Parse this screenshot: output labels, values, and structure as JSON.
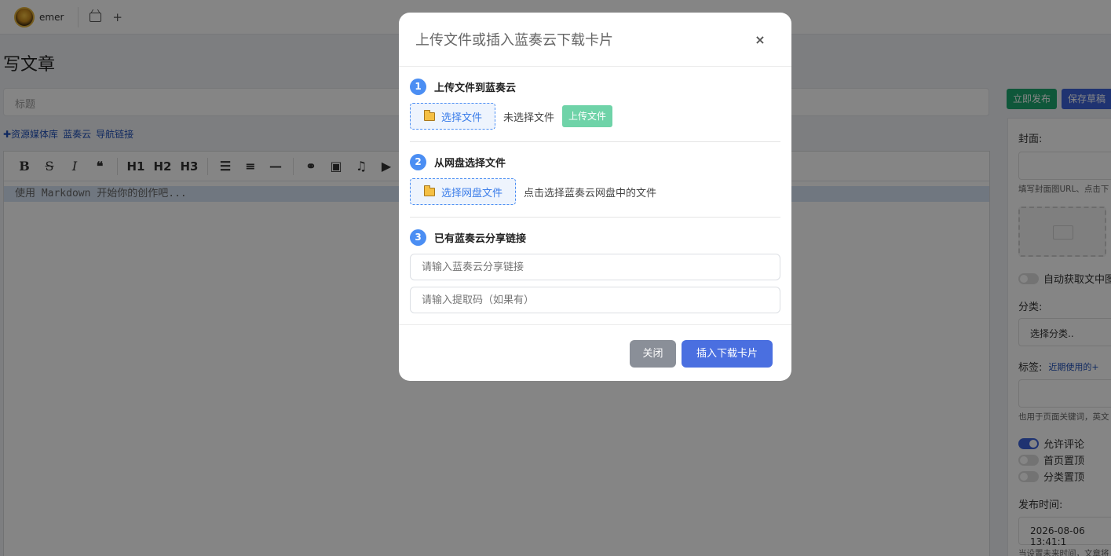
{
  "topbar": {
    "username": "emer",
    "add_symbol": "+"
  },
  "page": {
    "title": "写文章",
    "title_placeholder": "标题",
    "quick_links": [
      "✚资源媒体库",
      "蓝奏云",
      "导航链接"
    ],
    "toolbar": [
      "B",
      "S",
      "I",
      "❝",
      "H1",
      "H2",
      "H3",
      "☰",
      "≡",
      "—",
      "⚭",
      "▣",
      "♫",
      "▶"
    ],
    "editor_placeholder": "使用 Markdown 开始你的创作吧..."
  },
  "sidebar": {
    "publish_label": "立即发布",
    "draft_label": "保存草稿",
    "cover_label": "封面:",
    "cover_hint": "填写封面图URL、点击下",
    "auto_cover_label": "自动获取文中图",
    "category_label": "分类:",
    "category_value": "选择分类..",
    "tags_label": "标签:",
    "recent_tags": "近期使用的+",
    "tags_hint": "也用于页面关键词，英文",
    "allow_comments": "允许评论",
    "pin_home": "首页置顶",
    "pin_category": "分类置顶",
    "publish_time_label": "发布时间:",
    "publish_time_value": "2026-08-06 13:41:1",
    "publish_time_hint": "当设置未来时间，文章将"
  },
  "modal": {
    "title": "上传文件或插入蓝奏云下载卡片",
    "close_symbol": "×",
    "step1": {
      "number": "1",
      "title": "上传文件到蓝奏云",
      "choose_label": "选择文件",
      "status": "未选择文件",
      "upload_label": "上传文件"
    },
    "step2": {
      "number": "2",
      "title": "从网盘选择文件",
      "choose_label": "选择网盘文件",
      "note": "点击选择蓝奏云网盘中的文件"
    },
    "step3": {
      "number": "3",
      "title": "已有蓝奏云分享链接",
      "link_placeholder": "请输入蓝奏云分享链接",
      "code_placeholder": "请输入提取码（如果有）"
    },
    "close_label": "关闭",
    "insert_label": "插入下载卡片"
  },
  "colors": {
    "accent_blue": "#4a6fe0",
    "step_blue": "#4b8ef3",
    "upload_green": "#6fd3a8",
    "publish_green": "#1ea86f"
  }
}
